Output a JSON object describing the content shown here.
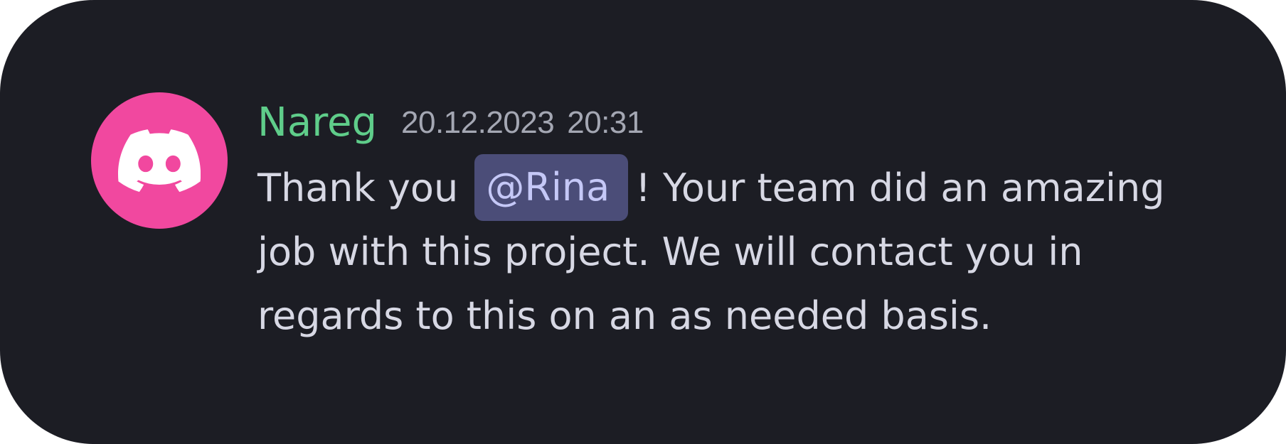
{
  "message": {
    "author": "Nareg",
    "date": "20.12.2023",
    "time": "20:31",
    "text_before_mention": "Thank you ",
    "mention": "@Rina",
    "line1_after_mention": "! Your team did an amazing",
    "line2": "job with this project. We will contact you in",
    "line3": "regards to this on an as needed basis."
  },
  "avatar": {
    "icon": "discord-logo-icon",
    "background_color": "#f1489f"
  },
  "colors": {
    "card_background": "#1c1d24",
    "author": "#5fcd8a",
    "timestamp": "#a4a7b3",
    "message_text": "#d7d8e4",
    "mention_background": "#4b4d78",
    "mention_text": "#c5c8f7"
  }
}
